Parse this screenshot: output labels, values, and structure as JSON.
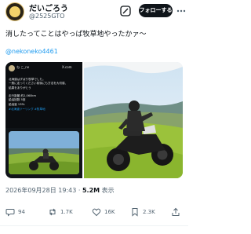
{
  "post": {
    "author_name": "だいごろう",
    "author_handle": "@2525GTO",
    "follow_label": "フォローする",
    "text": "消したってことはやっぱ牧草地やったかァ〜",
    "mention": "@nekoneko4461",
    "date_time": "2026年09月28日 19:43",
    "separator": "·",
    "views_count": "5.2M",
    "views_label": "表示"
  },
  "embedded_card": {
    "name": "ね こ_ne",
    "brand": "X.com",
    "lines": [
      "北海道はずばり牧草でした。",
      "一般に走ってください前後にも方法を大切感、",
      "結果をありがとう",
      "",
      "走行距離 約2,060km",
      "給油回数 5回",
      "給油量 135L"
    ],
    "tags": "#北海道ツーリング #牧草地"
  },
  "actions": {
    "replies": "94",
    "reposts": "1.7K",
    "likes": "16K",
    "bookmarks": "2.3K"
  },
  "colors": {
    "text": "#0f1419",
    "secondary": "#536471",
    "accent": "#1d9bf0",
    "follow_bg": "#0f1419"
  }
}
